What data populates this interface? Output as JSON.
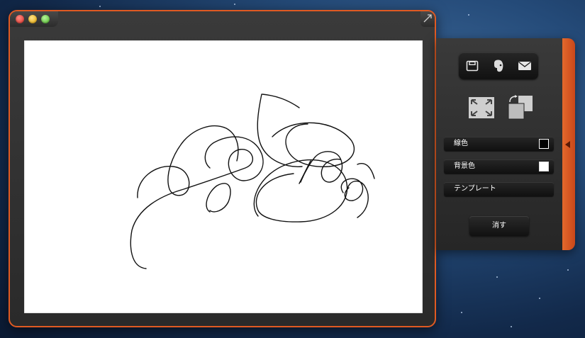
{
  "app": {
    "window_controls": [
      "close",
      "minimize",
      "zoom"
    ],
    "fullscreen_icon": "fullscreen-arrow-icon"
  },
  "canvas": {
    "background_color": "#ffffff",
    "stroke_color": "#111111"
  },
  "panel": {
    "accent_color": "#e05a22",
    "share_buttons": [
      "save-icon",
      "evernote-icon",
      "mail-icon"
    ],
    "view_buttons": [
      "fit-screen-icon",
      "rotate-swap-icon"
    ],
    "settings": {
      "line_color_label": "線色",
      "line_color_value": "#000000",
      "bg_color_label": "背景色",
      "bg_color_value": "#ffffff",
      "template_label": "テンプレート"
    },
    "clear_label": "消す"
  }
}
